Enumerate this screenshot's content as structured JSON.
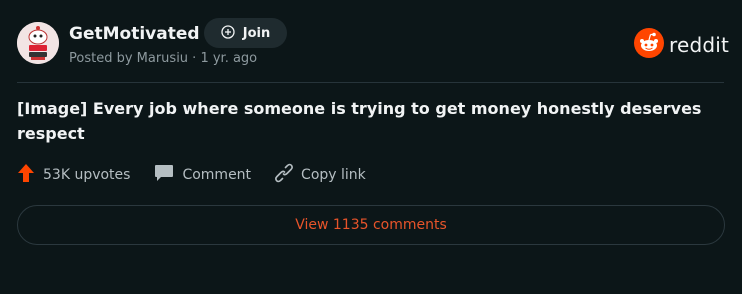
{
  "post": {
    "community": "GetMotivated",
    "join_label": "Join",
    "meta": "Posted by Marusiu · 1 yr. ago",
    "title": "[Image] Every job where someone is trying to get money honestly deserves respect"
  },
  "brand": {
    "wordmark": "reddit",
    "color": "#ff4500"
  },
  "avatar": {
    "logo_text": "TODAY / KEEPS"
  },
  "actions": {
    "upvotes": "53K upvotes",
    "comment": "Comment",
    "copy_link": "Copy link"
  },
  "footer": {
    "view_comments": "View 1135 comments"
  },
  "colors": {
    "background": "#0c1618",
    "accent": "#ff4500",
    "link_accent": "#e8542a",
    "muted_text": "#8d999e"
  },
  "icons": [
    "community-avatar-icon",
    "plus-circle-icon",
    "reddit-logo-icon",
    "upvote-arrow-icon",
    "comment-bubble-icon",
    "link-icon"
  ]
}
